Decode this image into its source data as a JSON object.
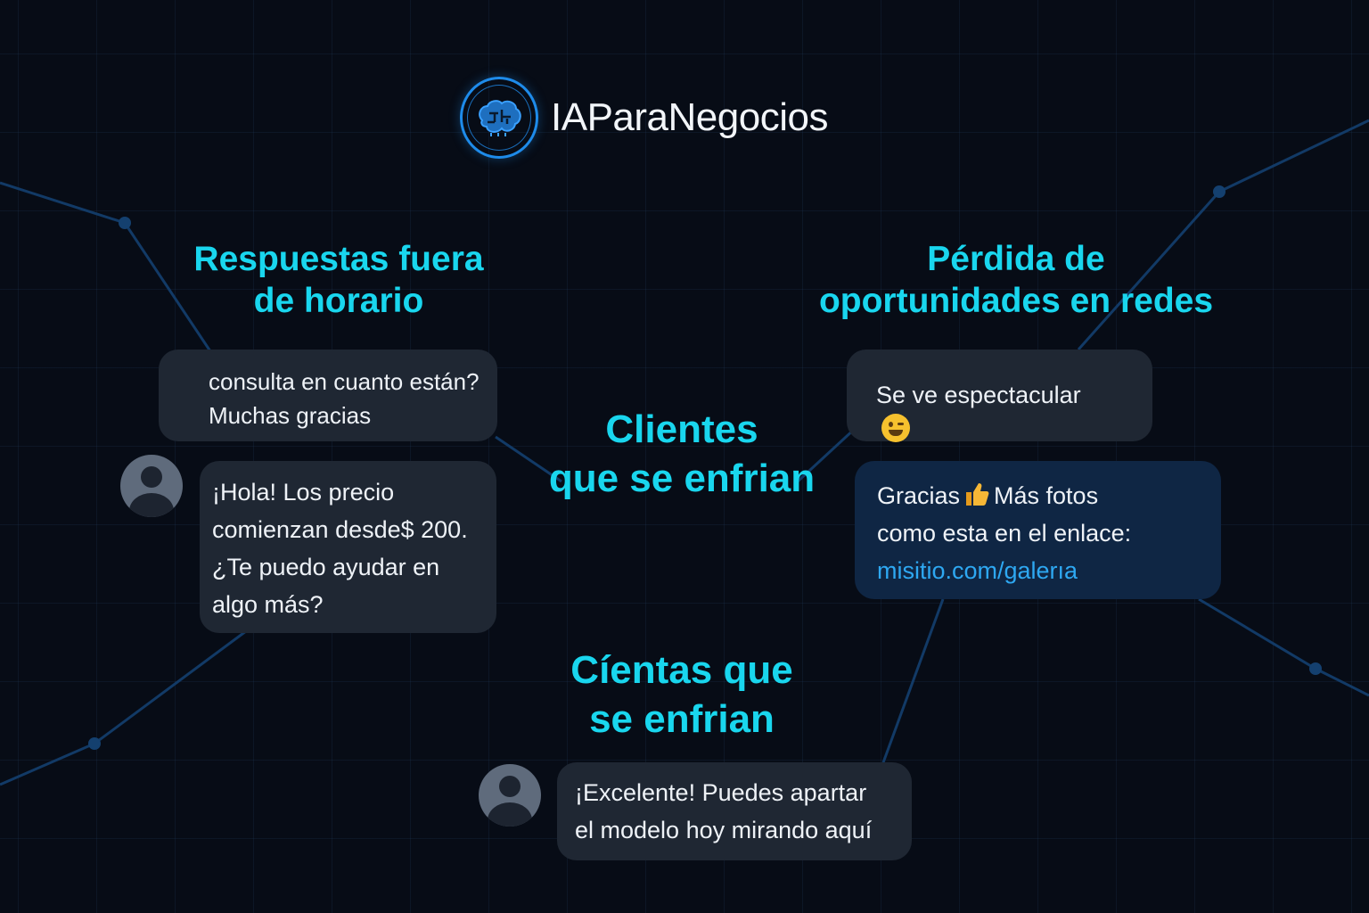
{
  "brand": {
    "name": "IAParaNegocios",
    "logo_icon": "brain-circuit-icon",
    "accent": "#1e8bea"
  },
  "colors": {
    "background": "#070c16",
    "heading": "#19d6ee",
    "bubble": "#1f2733",
    "bubble_highlight": "#0f2644",
    "link": "#2ea8f2"
  },
  "sections": {
    "left": {
      "title_line1": "Respuestas fuera",
      "title_line2": "de horario",
      "incoming_line1": "consulta en cuanto están?",
      "incoming_line2": "Muchas gracias",
      "reply_line1": "¡Hola! Los precio",
      "reply_line2": "comienzan desde$ 200.",
      "reply_line3": "¿Te puedo ayudar en",
      "reply_line4": "algo más?"
    },
    "center": {
      "title_line1": "Clientes",
      "title_line2": "que se enfrian"
    },
    "right": {
      "title_line1": "Pérdida de",
      "title_line2": "oportunidades en redes",
      "incoming": "Se ve espectacular",
      "incoming_emoji": "winking-smile-emoji-icon",
      "reply_part1": "Gracias",
      "reply_emoji": "thumbs-up-emoji-icon",
      "reply_part2": "Más fotos",
      "reply_line2": "como esta en el enlace:",
      "reply_link": "misitio.com/galerıa"
    },
    "bottom": {
      "title_line1": "Cíentas que",
      "title_line2": "se enfrian",
      "reply_line1": "¡Excelente! Puedes apartar",
      "reply_line2": "el modelo hoy mirando aquí"
    }
  }
}
